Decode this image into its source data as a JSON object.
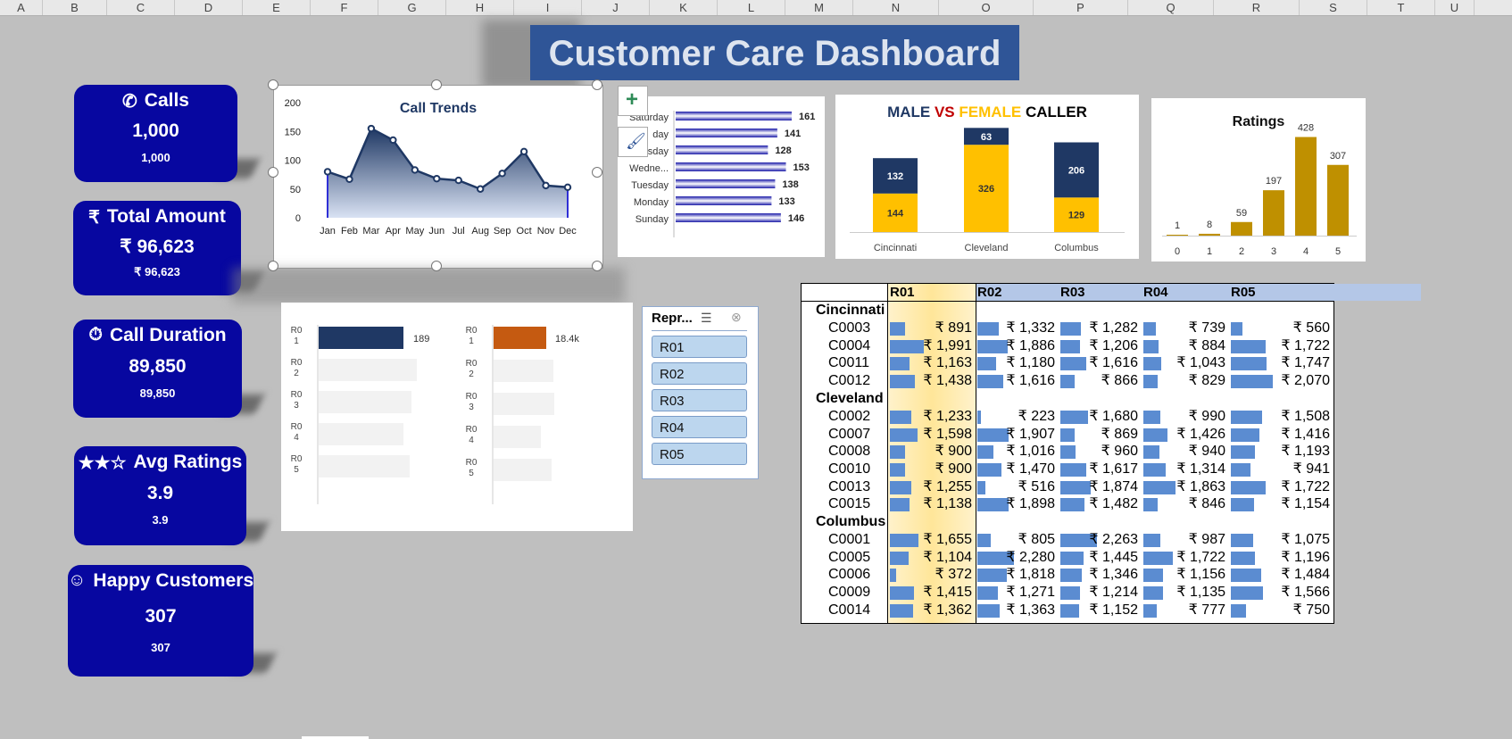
{
  "sheet": {
    "columns": [
      "A",
      "B",
      "C",
      "D",
      "E",
      "F",
      "G",
      "H",
      "I",
      "J",
      "K",
      "L",
      "M",
      "N",
      "O",
      "P",
      "Q",
      "R",
      "S",
      "T",
      "U"
    ]
  },
  "dashboard": {
    "title": "Customer Care Dashboard"
  },
  "kpis": [
    {
      "label": "Calls",
      "icon": "phone-icon",
      "glyph": "✆",
      "value": "1,000",
      "sub": "1,000"
    },
    {
      "label": "Total Amount",
      "icon": "rupee-icon",
      "glyph": "₹",
      "value": "₹ 96,623",
      "sub": "₹ 96,623"
    },
    {
      "label": "Call Duration",
      "icon": "stopwatch-icon",
      "glyph": "⏱",
      "value": "89,850",
      "sub": "89,850"
    },
    {
      "label": "Avg Ratings",
      "icon": "stars-icon",
      "glyph": "★★☆",
      "value": "3.9",
      "sub": "3.9"
    },
    {
      "label": "Happy Customers",
      "icon": "customer-support-icon",
      "glyph": "☺",
      "value": "307",
      "sub": "307"
    }
  ],
  "chart_data": [
    {
      "type": "area",
      "title": "Call Trends",
      "categories": [
        "Jan",
        "Feb",
        "Mar",
        "Apr",
        "May",
        "Jun",
        "Jul",
        "Aug",
        "Sep",
        "Oct",
        "Nov",
        "Dec"
      ],
      "values": [
        80,
        67,
        155,
        135,
        83,
        68,
        65,
        50,
        77,
        115,
        56,
        53
      ],
      "ylim": [
        0,
        200
      ],
      "yticks": [
        0,
        50,
        100,
        150,
        200
      ],
      "color": "#1f3864"
    },
    {
      "type": "bar",
      "orientation": "horizontal",
      "categories": [
        "Saturday",
        "Friday",
        "Thursday",
        "Wedne...",
        "Tuesday",
        "Monday",
        "Sunday"
      ],
      "category_display": [
        "Saturday",
        "day",
        "Thursday",
        "Wedne...",
        "Tuesday",
        "Monday",
        "Sunday"
      ],
      "values": [
        161,
        141,
        128,
        153,
        138,
        133,
        146
      ],
      "color": "#3b3bd6"
    },
    {
      "type": "bar",
      "stacked": true,
      "title_parts": [
        "MALE",
        "VS",
        "FEMALE",
        "CALLER"
      ],
      "title_colors": [
        "#1f3864",
        "#c00000",
        "#ffc000",
        "#000000"
      ],
      "categories": [
        "Cincinnati",
        "Cleveland",
        "Columbus"
      ],
      "series": [
        {
          "name": "FEMALE",
          "values": [
            144,
            326,
            129
          ],
          "color": "#ffc000"
        },
        {
          "name": "MALE",
          "values": [
            132,
            63,
            206
          ],
          "color": "#1f3864"
        }
      ]
    },
    {
      "type": "bar",
      "title": "Ratings",
      "categories": [
        "0",
        "1",
        "2",
        "3",
        "4",
        "5"
      ],
      "values": [
        1,
        8,
        59,
        197,
        428,
        307
      ],
      "color": "#bf9000"
    },
    {
      "type": "bar",
      "orientation": "horizontal",
      "categories": [
        "R01",
        "R02",
        "R03",
        "R04",
        "R05"
      ],
      "values": [
        189,
        null,
        null,
        null,
        null
      ],
      "labels": [
        "189",
        "",
        "",
        "",
        ""
      ],
      "color": "#1f3864"
    },
    {
      "type": "bar",
      "orientation": "horizontal",
      "categories": [
        "R01",
        "R02",
        "R03",
        "R04",
        "R05"
      ],
      "values": [
        18400,
        null,
        null,
        null,
        null
      ],
      "labels": [
        "18.4k",
        "",
        "",
        "",
        ""
      ],
      "color": "#c55a11"
    }
  ],
  "slicer": {
    "title": "Repr...",
    "items": [
      "R01",
      "R02",
      "R03",
      "R04",
      "R05"
    ]
  },
  "pivot": {
    "columns": [
      "R01",
      "R02",
      "R03",
      "R04",
      "R05"
    ],
    "groups": [
      {
        "city": "Cincinnati",
        "rows": [
          {
            "id": "C0003",
            "vals": [
              "₹ 891",
              "₹ 1,332",
              "₹ 1,282",
              "₹ 739",
              "₹ 560"
            ]
          },
          {
            "id": "C0004",
            "vals": [
              "₹ 1,991",
              "₹ 1,886",
              "₹ 1,206",
              "₹ 884",
              "₹ 1,722"
            ]
          },
          {
            "id": "C0011",
            "vals": [
              "₹ 1,163",
              "₹ 1,180",
              "₹ 1,616",
              "₹ 1,043",
              "₹ 1,747"
            ]
          },
          {
            "id": "C0012",
            "vals": [
              "₹ 1,438",
              "₹ 1,616",
              "₹ 866",
              "₹ 829",
              "₹ 2,070"
            ]
          }
        ]
      },
      {
        "city": "Cleveland",
        "rows": [
          {
            "id": "C0002",
            "vals": [
              "₹ 1,233",
              "₹ 223",
              "₹ 1,680",
              "₹ 990",
              "₹ 1,508"
            ]
          },
          {
            "id": "C0007",
            "vals": [
              "₹ 1,598",
              "₹ 1,907",
              "₹ 869",
              "₹ 1,426",
              "₹ 1,416"
            ]
          },
          {
            "id": "C0008",
            "vals": [
              "₹ 900",
              "₹ 1,016",
              "₹ 960",
              "₹ 940",
              "₹ 1,193"
            ]
          },
          {
            "id": "C0010",
            "vals": [
              "₹ 900",
              "₹ 1,470",
              "₹ 1,617",
              "₹ 1,314",
              "₹ 941"
            ]
          },
          {
            "id": "C0013",
            "vals": [
              "₹ 1,255",
              "₹ 516",
              "₹ 1,874",
              "₹ 1,863",
              "₹ 1,722"
            ]
          },
          {
            "id": "C0015",
            "vals": [
              "₹ 1,138",
              "₹ 1,898",
              "₹ 1,482",
              "₹ 846",
              "₹ 1,154"
            ]
          }
        ]
      },
      {
        "city": "Columbus",
        "rows": [
          {
            "id": "C0001",
            "vals": [
              "₹ 1,655",
              "₹ 805",
              "₹ 2,263",
              "₹ 987",
              "₹ 1,075"
            ]
          },
          {
            "id": "C0005",
            "vals": [
              "₹ 1,104",
              "₹ 2,280",
              "₹ 1,445",
              "₹ 1,722",
              "₹ 1,196"
            ]
          },
          {
            "id": "C0006",
            "vals": [
              "₹ 372",
              "₹ 1,818",
              "₹ 1,346",
              "₹ 1,156",
              "₹ 1,484"
            ]
          },
          {
            "id": "C0009",
            "vals": [
              "₹ 1,415",
              "₹ 1,271",
              "₹ 1,214",
              "₹ 1,135",
              "₹ 1,566"
            ]
          },
          {
            "id": "C0014",
            "vals": [
              "₹ 1,362",
              "₹ 1,363",
              "₹ 1,152",
              "₹ 777",
              "₹ 750"
            ]
          }
        ]
      }
    ]
  }
}
